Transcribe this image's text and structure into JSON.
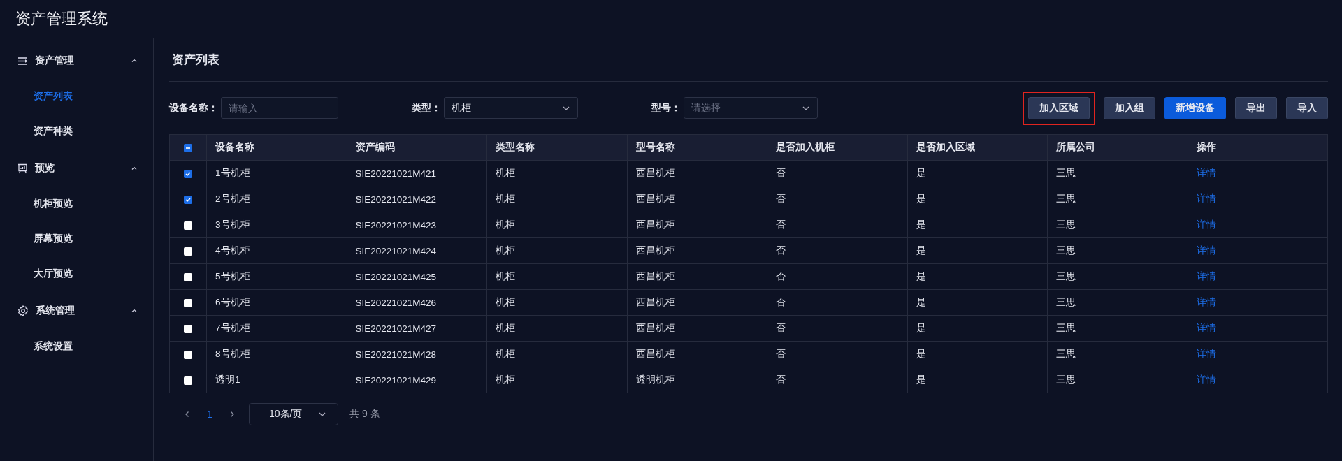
{
  "app_title": "资产管理系统",
  "sidebar": {
    "groups": [
      {
        "label": "资产管理",
        "expanded": true,
        "items": [
          {
            "label": "资产列表",
            "selected": true
          },
          {
            "label": "资产种类",
            "selected": false
          }
        ]
      },
      {
        "label": "预览",
        "expanded": true,
        "items": [
          {
            "label": "机柜预览",
            "selected": false
          },
          {
            "label": "屏幕预览",
            "selected": false
          },
          {
            "label": "大厅预览",
            "selected": false
          }
        ]
      },
      {
        "label": "系统管理",
        "expanded": true,
        "items": [
          {
            "label": "系统设置",
            "selected": false
          }
        ]
      }
    ]
  },
  "page_title": "资产列表",
  "filters": [
    {
      "label": "设备名称：",
      "kind": "input",
      "placeholder": "请输入"
    },
    {
      "label": "类型：",
      "kind": "select",
      "value": "机柜"
    },
    {
      "label": "型号：",
      "kind": "select",
      "placeholder": "请选择"
    }
  ],
  "toolbar": {
    "buttons": [
      {
        "label": "加入区域",
        "primary": false,
        "highlighted": true
      },
      {
        "label": "加入组",
        "primary": false,
        "highlighted": false
      },
      {
        "label": "新增设备",
        "primary": true,
        "highlighted": false
      },
      {
        "label": "导出",
        "primary": false,
        "highlighted": false
      },
      {
        "label": "导入",
        "primary": false,
        "highlighted": false
      }
    ]
  },
  "table": {
    "header_checkbox": {
      "indeterminate": true
    },
    "columns": [
      "设备名称",
      "资产编码",
      "类型名称",
      "型号名称",
      "是否加入机柜",
      "是否加入区域",
      "所属公司",
      "操作"
    ],
    "rows": [
      {
        "checked": true,
        "cells": [
          "1号机柜",
          "SIE20221021M421",
          "机柜",
          "西昌机柜",
          "否",
          "是",
          "三思"
        ],
        "action": "详情"
      },
      {
        "checked": true,
        "cells": [
          "2号机柜",
          "SIE20221021M422",
          "机柜",
          "西昌机柜",
          "否",
          "是",
          "三思"
        ],
        "action": "详情"
      },
      {
        "checked": false,
        "cells": [
          "3号机柜",
          "SIE20221021M423",
          "机柜",
          "西昌机柜",
          "否",
          "是",
          "三思"
        ],
        "action": "详情"
      },
      {
        "checked": false,
        "cells": [
          "4号机柜",
          "SIE20221021M424",
          "机柜",
          "西昌机柜",
          "否",
          "是",
          "三思"
        ],
        "action": "详情"
      },
      {
        "checked": false,
        "cells": [
          "5号机柜",
          "SIE20221021M425",
          "机柜",
          "西昌机柜",
          "否",
          "是",
          "三思"
        ],
        "action": "详情"
      },
      {
        "checked": false,
        "cells": [
          "6号机柜",
          "SIE20221021M426",
          "机柜",
          "西昌机柜",
          "否",
          "是",
          "三思"
        ],
        "action": "详情"
      },
      {
        "checked": false,
        "cells": [
          "7号机柜",
          "SIE20221021M427",
          "机柜",
          "西昌机柜",
          "否",
          "是",
          "三思"
        ],
        "action": "详情"
      },
      {
        "checked": false,
        "cells": [
          "8号机柜",
          "SIE20221021M428",
          "机柜",
          "西昌机柜",
          "否",
          "是",
          "三思"
        ],
        "action": "详情"
      },
      {
        "checked": false,
        "cells": [
          "透明1",
          "SIE20221021M429",
          "机柜",
          "透明机柜",
          "否",
          "是",
          "三思"
        ],
        "action": "详情"
      }
    ]
  },
  "pagination": {
    "pages": [
      {
        "label": "1",
        "selected": true
      }
    ],
    "page_size": "10条/页",
    "total": "共 9 条"
  }
}
